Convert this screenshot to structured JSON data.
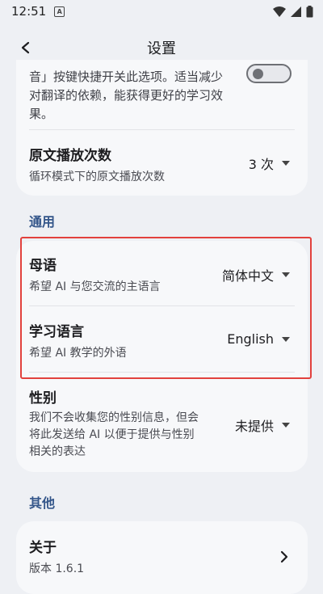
{
  "status_bar": {
    "time": "12:51",
    "notif_icon": "A"
  },
  "app_bar": {
    "title": "设置"
  },
  "card_top": {
    "partial_text_1": "音」按键快捷开关此选项。适当减少",
    "partial_text_2": "对翻译的依赖，能获得更好的学习效",
    "partial_text_3": "果。",
    "playback": {
      "title": "原文播放次数",
      "subtitle": "循环模式下的原文播放次数",
      "value": "3 次"
    }
  },
  "section_general": "通用",
  "general": {
    "native_language": {
      "title": "母语",
      "subtitle": "希望 AI 与您交流的主语言",
      "value": "简体中文"
    },
    "learning_language": {
      "title": "学习语言",
      "subtitle": "希望 AI 教学的外语",
      "value": "English"
    },
    "gender": {
      "title": "性别",
      "subtitle_lines": [
        "我们不会收集您的性别信息，但会",
        "将此发送给 AI 以便于提供与性别",
        "相关的表达"
      ],
      "value": "未提供"
    }
  },
  "section_other": "其他",
  "other": {
    "about": {
      "title": "关于",
      "subtitle": "版本 1.6.1"
    }
  },
  "colors": {
    "accent": "#34568a",
    "highlight": "#e2413d",
    "card": "#f7f8fa",
    "background": "#eef0f4"
  }
}
